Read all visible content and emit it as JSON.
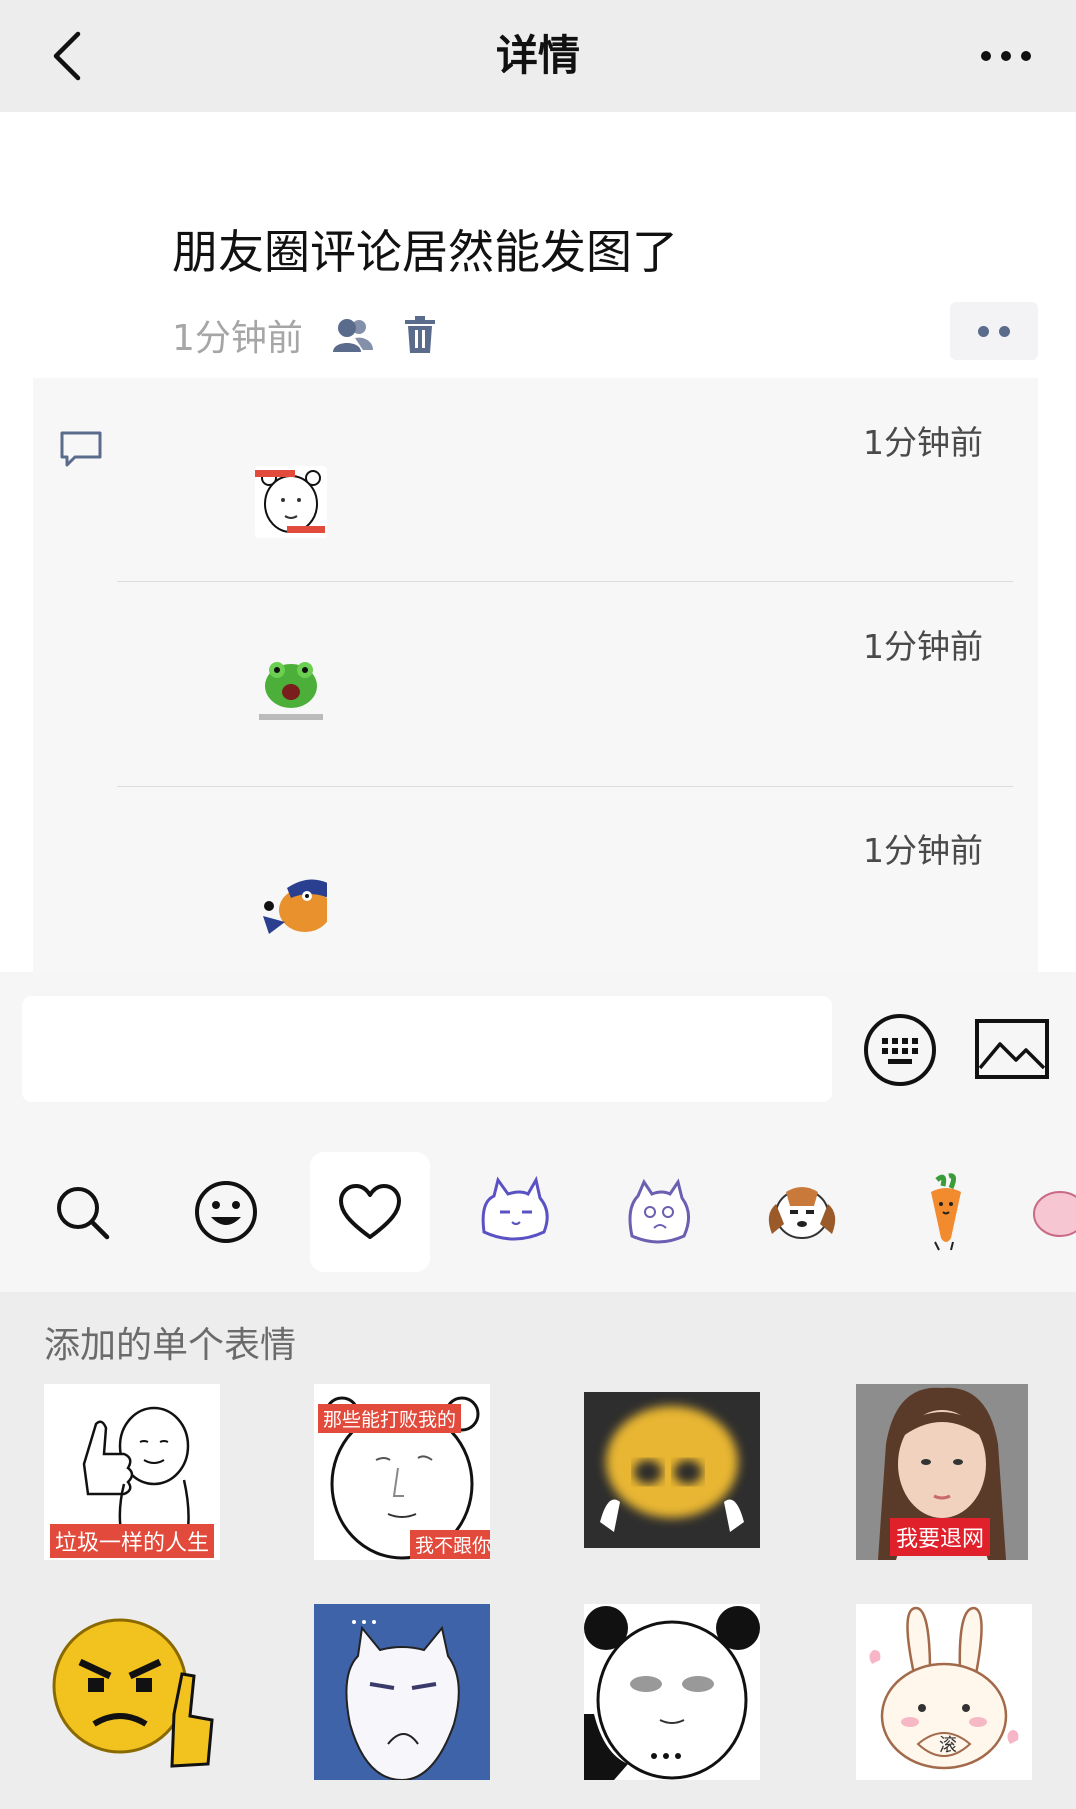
{
  "navbar": {
    "title": "详情"
  },
  "post": {
    "text": "朋友圈评论居然能发图了",
    "time": "1分钟前"
  },
  "comments": [
    {
      "time": "1分钟前",
      "sticker": "bear-face-sticker"
    },
    {
      "time": "1分钟前",
      "sticker": "green-frog-sticker"
    },
    {
      "time": "1分钟前",
      "sticker": "swiper-fox-sticker"
    }
  ],
  "input": {
    "placeholder": ""
  },
  "tabs": [
    "search-icon",
    "smiley-icon",
    "heart-icon",
    "cat-sticker-pack",
    "cat-sketch-pack",
    "beagle-pack",
    "carrot-pack"
  ],
  "panel": {
    "title": "添加的单个表情",
    "stickers": [
      {
        "name": "thumbs-up-sticker",
        "caption": "垃圾一样的人生"
      },
      {
        "name": "bear-face-sticker",
        "caption": "那些能打败我的",
        "caption2": "我不跟你打"
      },
      {
        "name": "blurry-emoji-sticker",
        "caption": ""
      },
      {
        "name": "girl-photo-sticker",
        "caption": "我要退网"
      },
      {
        "name": "angry-emoji-sticker",
        "caption": ""
      },
      {
        "name": "blue-cat-sticker",
        "caption": ""
      },
      {
        "name": "panda-face-sticker",
        "caption": ""
      },
      {
        "name": "bunny-sticker",
        "caption": "滚"
      }
    ]
  },
  "colors": {
    "background": "#ededed",
    "link": "#5b6b8c",
    "meta": "#a6a6a6"
  }
}
